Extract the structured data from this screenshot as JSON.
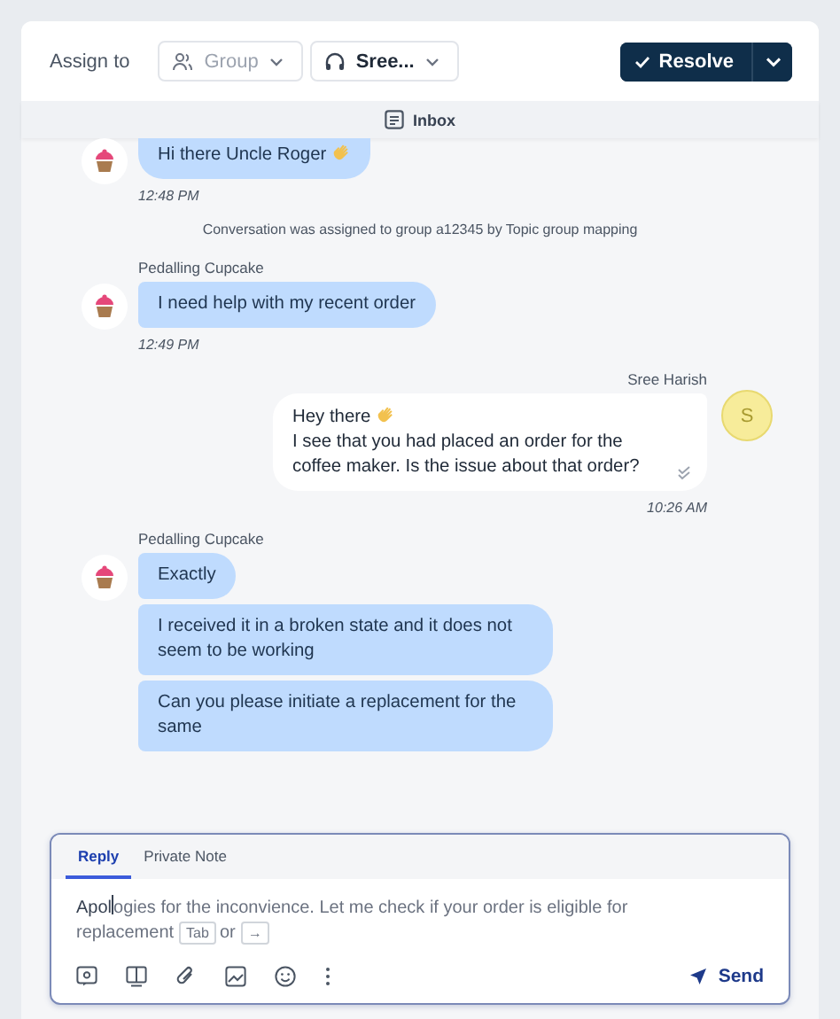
{
  "toolbar": {
    "assign_label": "Assign to",
    "group": {
      "label": "Group"
    },
    "agent": {
      "label": "Sree..."
    },
    "resolve": {
      "label": "Resolve"
    }
  },
  "inbox": {
    "label": "Inbox"
  },
  "messages": [
    {
      "kind": "incoming",
      "bubbles": [
        {
          "text": "Hi there Uncle Roger",
          "wave": true
        }
      ],
      "time": "12:48 PM"
    },
    {
      "kind": "system",
      "text": "Conversation was assigned to group a12345 by Topic group mapping"
    },
    {
      "kind": "incoming",
      "sender": "Pedalling Cupcake",
      "bubbles": [
        {
          "text": "I need help with my recent order",
          "wave": false
        }
      ],
      "time": "12:49 PM"
    },
    {
      "kind": "outgoing",
      "sender": "Sree Harish",
      "avatar": "S",
      "lines": [
        {
          "text": "Hey there",
          "wave": true
        },
        {
          "text": "I see that you had placed an order for the coffee maker. Is the issue about that order?",
          "wave": false
        }
      ],
      "read": true,
      "time": "10:26 AM"
    },
    {
      "kind": "incoming",
      "sender": "Pedalling Cupcake",
      "bubbles": [
        {
          "text": "Exactly",
          "wave": false
        },
        {
          "text": "I received it in a broken state and it does not seem to be working",
          "wave": false
        },
        {
          "text": "Can you please initiate a replacement for the same",
          "wave": false
        }
      ]
    }
  ],
  "compose": {
    "tabs": [
      {
        "label": "Reply",
        "selected": true
      },
      {
        "label": "Private Note",
        "selected": false
      }
    ],
    "typed": "Apol",
    "suggestion": "ogies for the inconvience. Let me check if your order is eligible for replacement",
    "keys": [
      "Tab",
      "→"
    ],
    "key_separator": "or",
    "send": "Send"
  }
}
